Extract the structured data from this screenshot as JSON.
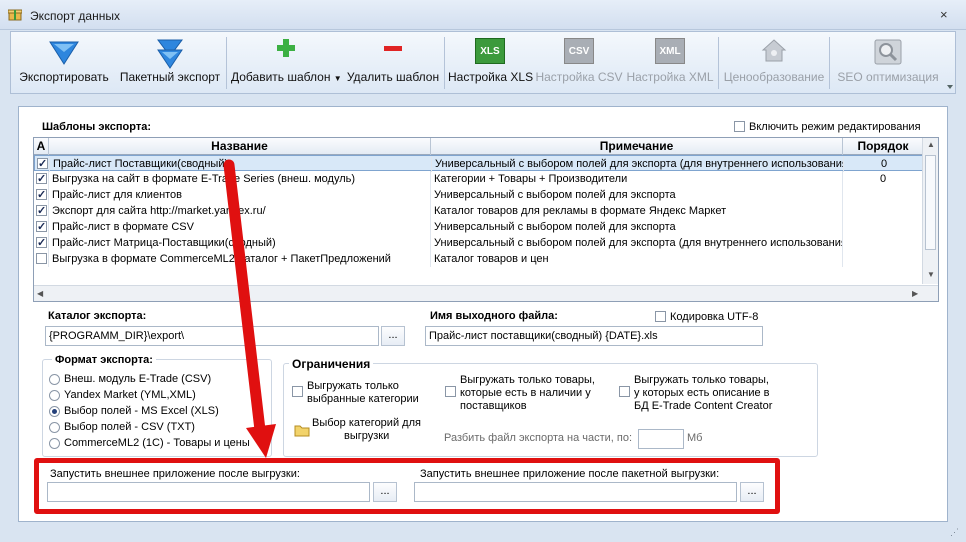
{
  "window": {
    "title": "Экспорт данных",
    "close": "×"
  },
  "toolbar": {
    "export": "Экспортировать",
    "batch": "Пакетный экспорт",
    "add_template": "Добавить шаблон",
    "delete_template": "Удалить шаблон",
    "xls_settings": "Настройка XLS",
    "csv_settings": "Настройка CSV",
    "xml_settings": "Настройка XML",
    "pricing": "Ценообразование",
    "seo": "SEO оптимизация",
    "xls_icon": "XLS",
    "csv_icon": "CSV",
    "xml_icon": "XML"
  },
  "templates": {
    "title": "Шаблоны экспорта:",
    "edit_mode": "Включить режим редактирования",
    "headers": {
      "a": "A",
      "name": "Название",
      "note": "Примечание",
      "order": "Порядок"
    },
    "rows": [
      {
        "checked": true,
        "name": "Прайс-лист Поставщики(сводный)",
        "note": "Универсальный с выбором полей для экспорта (для внутреннего использования",
        "order": "0"
      },
      {
        "checked": true,
        "name": "Выгрузка на сайт в формате E-Trade Series (внеш. модуль)",
        "note": "Категории + Товары + Производители",
        "order": "0"
      },
      {
        "checked": true,
        "name": "Прайс-лист для клиентов",
        "note": "Универсальный с выбором полей для экспорта",
        "order": ""
      },
      {
        "checked": true,
        "name": "Экспорт для сайта http://market.yandex.ru/",
        "note": "Каталог товаров для рекламы в формате Яндекс Маркет",
        "order": ""
      },
      {
        "checked": true,
        "name": "Прайс-лист в формате CSV",
        "note": "Универсальный с выбором полей для экспорта",
        "order": ""
      },
      {
        "checked": true,
        "name": "Прайс-лист Матрица-Поставщики(сводный)",
        "note": "Универсальный с выбором полей для экспорта (для внутреннего использования",
        "order": ""
      },
      {
        "checked": false,
        "name": "Выгрузка в формате CommerceML2 Каталог + ПакетПредложений",
        "note": "Каталог товаров и цен",
        "order": ""
      }
    ]
  },
  "catalog": {
    "label": "Каталог экспорта:",
    "value": "{PROGRAMM_DIR}\\export\\"
  },
  "outfile": {
    "label": "Имя выходного файла:",
    "value": "Прайс-лист поставщики(сводный) {DATE}.xls",
    "utf8": "Кодировка UTF-8"
  },
  "format": {
    "title": "Формат экспорта:",
    "options": [
      {
        "label": "Внеш. модуль E-Trade (CSV)",
        "selected": false
      },
      {
        "label": "Yandex Market (YML,XML)",
        "selected": false
      },
      {
        "label": "Выбор полей - MS Excel (XLS)",
        "selected": true
      },
      {
        "label": "Выбор полей - CSV (TXT)",
        "selected": false
      },
      {
        "label": "CommerceML2 (1C) - Товары и цены",
        "selected": false
      }
    ]
  },
  "limits": {
    "title": "Ограничения",
    "selected_cats_1": "Выгружать только",
    "selected_cats_2": "выбранные категории",
    "in_stock_1": "Выгружать только товары,",
    "in_stock_2": "которые есть в наличии у",
    "in_stock_3": "поставщиков",
    "with_desc_1": "Выгружать только товары,",
    "with_desc_2": "у которых есть описание в",
    "with_desc_3": "БД E-Trade Content Creator",
    "choose_cats_1": "Выбор категорий для",
    "choose_cats_2": "выгрузки",
    "split_label": "Разбить файл экспорта на части, по:",
    "split_value": "",
    "unit": "Мб"
  },
  "run_after": {
    "export_label": "Запустить внешнее приложение после выгрузки:",
    "export_value": "",
    "batch_label": "Запустить внешнее приложение после пакетной выгрузки:",
    "batch_value": "",
    "dots": "..."
  },
  "colors": {
    "annotation_red": "#e01010",
    "accent_blue": "#2f7fd8"
  }
}
